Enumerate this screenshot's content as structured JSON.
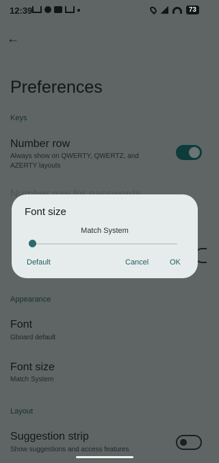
{
  "status_bar": {
    "time": "12:39",
    "battery": "73"
  },
  "page": {
    "title": "Preferences",
    "sections": {
      "keys": "Keys",
      "appearance": "Appearance",
      "layout": "Layout"
    },
    "number_row": {
      "title": "Number row",
      "subtitle": "Always show on QWERTY, QWERTZ, and AZERTY layouts",
      "enabled": true
    },
    "obscured_item": "Number row for passwords",
    "font": {
      "title": "Font",
      "subtitle": "Gboard default"
    },
    "font_size": {
      "title": "Font size",
      "subtitle": "Match System"
    },
    "suggestion_strip": {
      "title": "Suggestion strip",
      "subtitle": "Show suggestions and access features",
      "enabled": false
    }
  },
  "dialog": {
    "title": "Font size",
    "value_label": "Match System",
    "slider_value": 0,
    "buttons": {
      "default": "Default",
      "cancel": "Cancel",
      "ok": "OK"
    }
  },
  "colors": {
    "accent": "#2c6a6a",
    "scrim_bg": "#5f6564",
    "dialog_bg": "#e6ecec"
  }
}
